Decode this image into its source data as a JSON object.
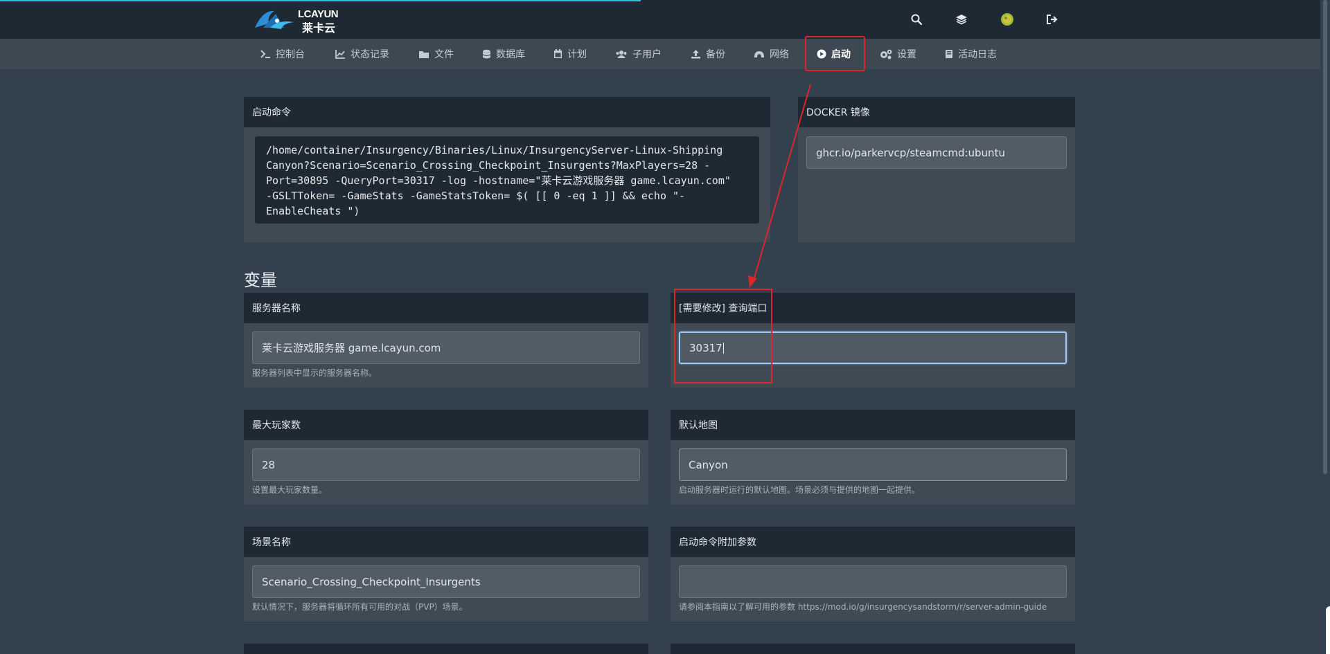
{
  "brand": {
    "name_en": "LCAYUN",
    "name_cn": "莱卡云"
  },
  "header_icons": [
    "search-icon",
    "layers-icon",
    "avatar",
    "logout-icon"
  ],
  "nav": {
    "items": [
      {
        "label": "控制台",
        "icon": "terminal-icon"
      },
      {
        "label": "状态记录",
        "icon": "chart-icon"
      },
      {
        "label": "文件",
        "icon": "folder-icon"
      },
      {
        "label": "数据库",
        "icon": "database-icon"
      },
      {
        "label": "计划",
        "icon": "calendar-icon"
      },
      {
        "label": "子用户",
        "icon": "users-icon"
      },
      {
        "label": "备份",
        "icon": "upload-icon"
      },
      {
        "label": "网络",
        "icon": "network-icon"
      },
      {
        "label": "启动",
        "icon": "play-circle-icon",
        "active": true
      },
      {
        "label": "设置",
        "icon": "gears-icon"
      },
      {
        "label": "活动日志",
        "icon": "book-icon"
      }
    ]
  },
  "startup": {
    "title": "启动命令",
    "command": "/home/container/Insurgency/Binaries/Linux/InsurgencyServer-Linux-Shipping\nCanyon?Scenario=Scenario_Crossing_Checkpoint_Insurgents?MaxPlayers=28 -\nPort=30895 -QueryPort=30317 -log -hostname=\"莱卡云游戏服务器 game.lcayun.com\"\n-GSLTToken= -GameStats -GameStatsToken= $( [[ 0 -eq 1 ]] && echo \"-\nEnableCheats \")"
  },
  "docker": {
    "title": "DOCKER 镜像",
    "value": "ghcr.io/parkervcp/steamcmd:ubuntu"
  },
  "variables": {
    "heading": "变量",
    "server_name": {
      "title": "服务器名称",
      "value": "莱卡云游戏服务器 game.lcayun.com",
      "help": "服务器列表中显示的服务器名称。"
    },
    "query_port": {
      "title": "[需要修改] 查询端口",
      "value": "30317"
    },
    "max_players": {
      "title": "最大玩家数",
      "value": "28",
      "help": "设置最大玩家数量。"
    },
    "default_map": {
      "title": "默认地图",
      "value": "Canyon",
      "help": "启动服务器时运行的默认地图。场景必须与提供的地图一起提供。"
    },
    "scenario": {
      "title": "场景名称",
      "value": "Scenario_Crossing_Checkpoint_Insurgents",
      "help": "默认情况下，服务器将循环所有可用的对战（PVP）场景。"
    },
    "extra_args": {
      "title": "启动命令附加参数",
      "value": "",
      "help": "请参阅本指南以了解可用的参数 https://mod.io/g/insurgencysandstorm/r/server-admin-guide"
    }
  },
  "colors": {
    "accent": "#2ec4dc",
    "highlight": "#e0242c",
    "panel_head": "#1f2933",
    "bg": "#33404d"
  }
}
